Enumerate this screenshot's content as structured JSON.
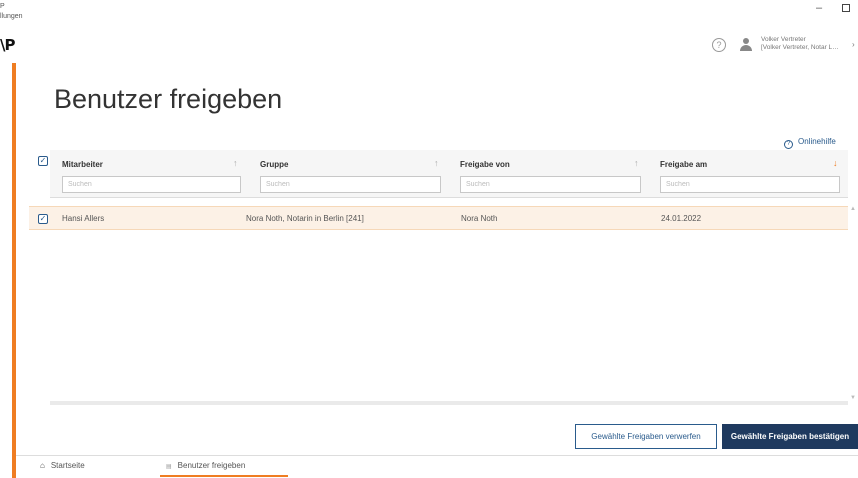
{
  "window": {
    "top_left_line1": "P",
    "top_left_line2": "llungen",
    "logo": "\\P",
    "minimize": "–"
  },
  "header": {
    "help_icon": "?",
    "user_line1": "Volker Vertreter",
    "user_line2": "[Volker Vertreter, Notar L…",
    "chevron": "›"
  },
  "page": {
    "title": "Benutzer freigeben",
    "help_link": "Onlinehilfe"
  },
  "table": {
    "columns": [
      {
        "label": "Mitarbeiter",
        "placeholder": "Suchen",
        "sort_icon": "↑"
      },
      {
        "label": "Gruppe",
        "placeholder": "Suchen",
        "sort_icon": "↑"
      },
      {
        "label": "Freigabe von",
        "placeholder": "Suchen",
        "sort_icon": "↑"
      },
      {
        "label": "Freigabe am",
        "placeholder": "Suchen",
        "sort_icon": "↓"
      }
    ],
    "rows": [
      {
        "checked": true,
        "mitarbeiter": "Hansi Allers",
        "gruppe": "Nora Noth, Notarin in Berlin [241]",
        "freigabe_von": "Nora Noth",
        "freigabe_am": "24.01.2022"
      }
    ]
  },
  "actions": {
    "reject_label": "Gewählte Freigaben verwerfen",
    "confirm_label": "Gewählte Freigaben bestätigen"
  },
  "tabs": [
    {
      "label": "Startseite",
      "icon": "home-icon"
    },
    {
      "label": "Benutzer freigeben",
      "icon": "document-icon",
      "active": true
    }
  ],
  "colors": {
    "accent": "#ef7d22",
    "primary": "#1f3a5f",
    "link": "#2a5b8c",
    "selected_row": "#fcf1e6"
  }
}
